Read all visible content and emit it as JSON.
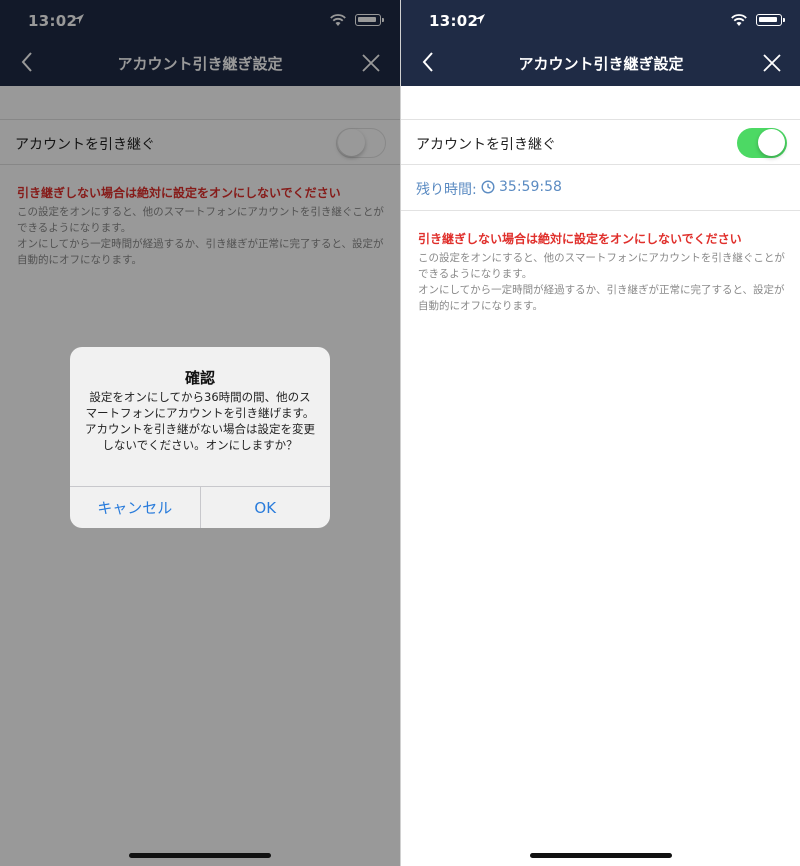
{
  "left": {
    "status": {
      "time": "13:02"
    },
    "nav": {
      "title": "アカウント引き継ぎ設定"
    },
    "toggle_row": {
      "label": "アカウントを引き継ぐ",
      "state": "off"
    },
    "notes": {
      "warning": "引き継ぎしない場合は絶対に設定をオンにしないでください",
      "description": "この設定をオンにすると、他のスマートフォンにアカウントを引き継ぐことができるようになります。\nオンにしてから一定時間が経過するか、引き継ぎが正常に完了すると、設定が自動的にオフになります。"
    },
    "dialog": {
      "title": "確認",
      "message": "設定をオンにしてから36時間の間、他のスマートフォンにアカウントを引き継げます。\nアカウントを引き継がない場合は設定を変更しないでください。オンにしますか？",
      "cancel_label": "キャンセル",
      "ok_label": "OK"
    }
  },
  "right": {
    "status": {
      "time": "13:02"
    },
    "nav": {
      "title": "アカウント引き継ぎ設定"
    },
    "toggle_row": {
      "label": "アカウントを引き継ぐ",
      "state": "on"
    },
    "remaining": {
      "label": "残り時間:",
      "value": "35:59:58"
    },
    "notes": {
      "warning": "引き継ぎしない場合は絶対に設定をオンにしないでください",
      "description": "この設定をオンにすると、他のスマートフォンにアカウントを引き継ぐことができるようになります。\nオンにしてから一定時間が経過するか、引き継ぎが正常に完了すると、設定が自動的にオフになります。"
    }
  },
  "colors": {
    "nav_bg": "#1f2b45",
    "toggle_on": "#4cd964",
    "warning": "#e0302c",
    "link_blue": "#2a7cdb",
    "timer_blue": "#5b8bc2"
  },
  "icons": {
    "back": "chevron-left-icon",
    "close": "close-icon",
    "clock": "clock-icon",
    "location": "location-arrow-icon",
    "wifi": "wifi-icon",
    "battery": "battery-icon"
  }
}
